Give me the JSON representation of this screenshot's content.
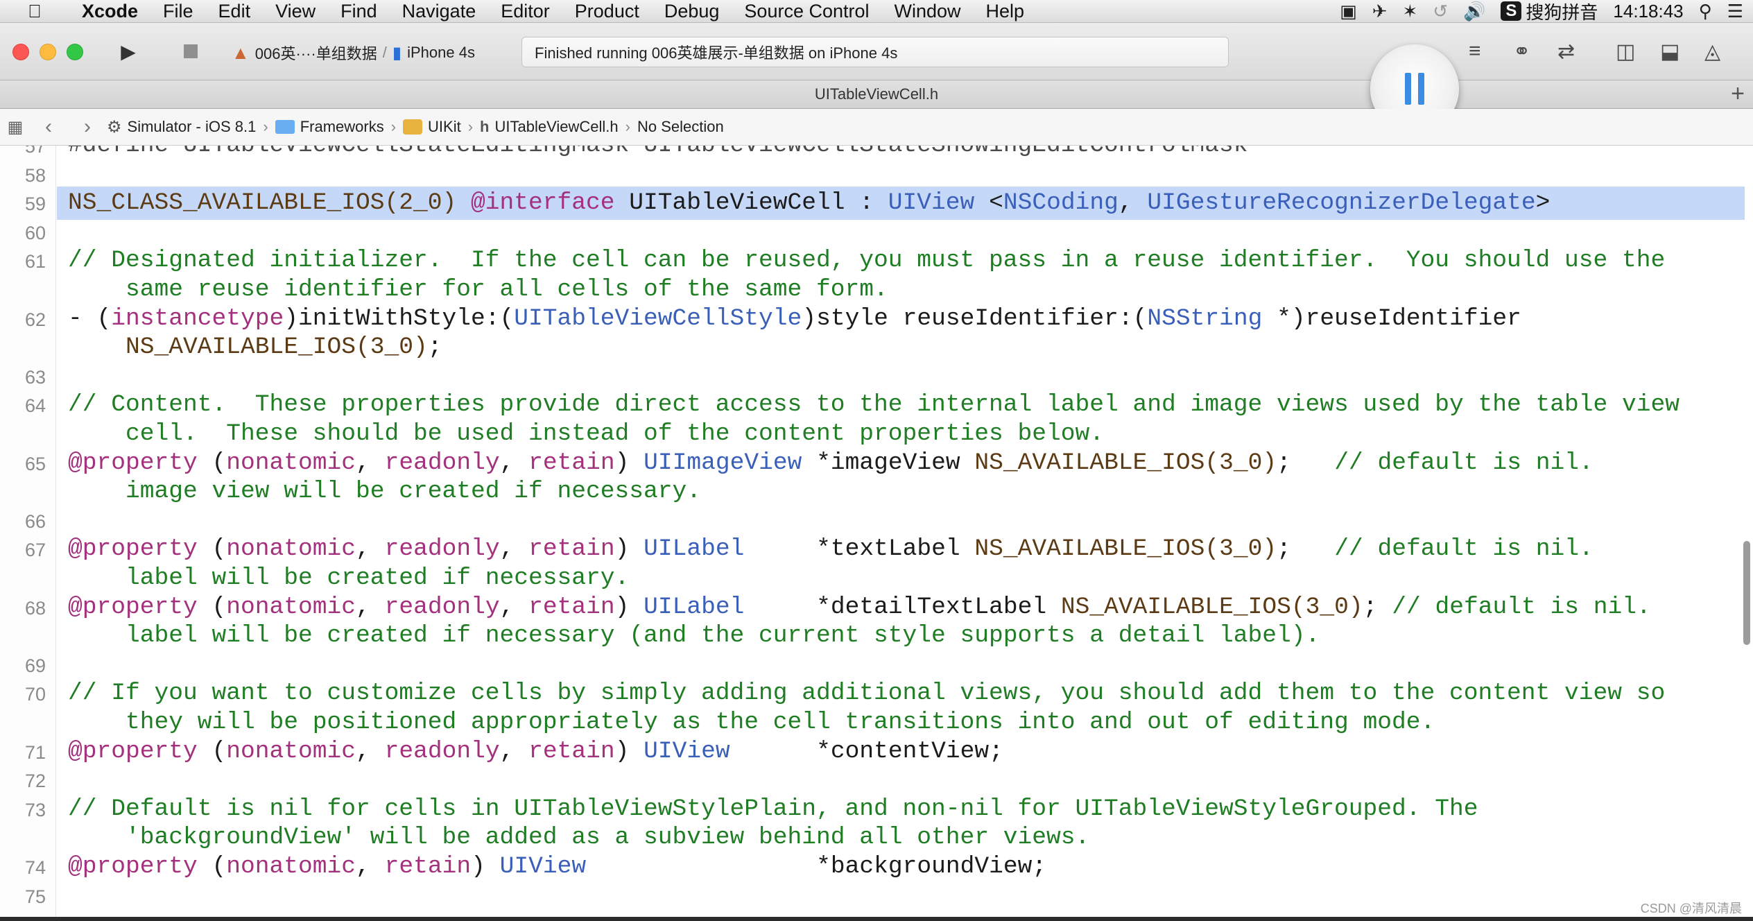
{
  "menubar": {
    "app_name": "Xcode",
    "items": [
      "File",
      "Edit",
      "View",
      "Find",
      "Navigate",
      "Editor",
      "Product",
      "Debug",
      "Source Control",
      "Window",
      "Help"
    ],
    "ime_label": "搜狗拼音",
    "ime_badge": "S",
    "clock": "14:18:43"
  },
  "toolbar": {
    "scheme_name": "006英····单组数据",
    "device": "iPhone 4s",
    "activity_status": "Finished running 006英雄展示-单组数据 on iPhone 4s"
  },
  "tabbar": {
    "title": "UITableViewCell.h",
    "add_tab_symbol": "+"
  },
  "jumpbar": {
    "crumbs": [
      "Simulator - iOS 8.1",
      "Frameworks",
      "UIKit",
      "UITableViewCell.h",
      "No Selection"
    ]
  },
  "editor": {
    "lines": [
      {
        "num": "57",
        "tokens": [
          {
            "c": "t-faded",
            "t": "#define UITableViewCellStateEditingMask UITableViewCellStateShowingEditControlMask"
          }
        ]
      },
      {
        "num": "58",
        "tokens": []
      },
      {
        "num": "59",
        "highlight": true,
        "tokens": [
          {
            "c": "t-macro",
            "t": "NS_CLASS_AVAILABLE_IOS(2_0) "
          },
          {
            "c": "t-kw",
            "t": "@interface"
          },
          {
            "c": "t-plain",
            "t": " UITableViewCell : "
          },
          {
            "c": "t-type",
            "t": "UIView"
          },
          {
            "c": "t-plain",
            "t": " <"
          },
          {
            "c": "t-type",
            "t": "NSCoding"
          },
          {
            "c": "t-plain",
            "t": ", "
          },
          {
            "c": "t-type",
            "t": "UIGestureRecognizerDelegate"
          },
          {
            "c": "t-plain",
            "t": ">"
          }
        ]
      },
      {
        "num": "60",
        "tokens": []
      },
      {
        "num": "61",
        "tokens": [
          {
            "c": "t-comment",
            "t": "// Designated initializer.  If the cell can be reused, you must pass in a reuse identifier.  You should use the"
          }
        ]
      },
      {
        "num": "",
        "tokens": [
          {
            "c": "t-comment",
            "t": "    same reuse identifier for all cells of the same form."
          }
        ]
      },
      {
        "num": "62",
        "tokens": [
          {
            "c": "t-plain",
            "t": "- ("
          },
          {
            "c": "t-kw",
            "t": "instancetype"
          },
          {
            "c": "t-plain",
            "t": ")initWithStyle:("
          },
          {
            "c": "t-type",
            "t": "UITableViewCellStyle"
          },
          {
            "c": "t-plain",
            "t": ")style reuseIdentifier:("
          },
          {
            "c": "t-type",
            "t": "NSString"
          },
          {
            "c": "t-plain",
            "t": " *)reuseIdentifier"
          }
        ]
      },
      {
        "num": "",
        "tokens": [
          {
            "c": "t-macro",
            "t": "    NS_AVAILABLE_IOS(3_0)"
          },
          {
            "c": "t-plain",
            "t": ";"
          }
        ]
      },
      {
        "num": "63",
        "tokens": []
      },
      {
        "num": "64",
        "tokens": [
          {
            "c": "t-comment",
            "t": "// Content.  These properties provide direct access to the internal label and image views used by the table view"
          }
        ]
      },
      {
        "num": "",
        "tokens": [
          {
            "c": "t-comment",
            "t": "    cell.  These should be used instead of the content properties below."
          }
        ]
      },
      {
        "num": "65",
        "tokens": [
          {
            "c": "t-kw",
            "t": "@property"
          },
          {
            "c": "t-plain",
            "t": " ("
          },
          {
            "c": "t-kw",
            "t": "nonatomic"
          },
          {
            "c": "t-plain",
            "t": ", "
          },
          {
            "c": "t-kw",
            "t": "readonly"
          },
          {
            "c": "t-plain",
            "t": ", "
          },
          {
            "c": "t-kw",
            "t": "retain"
          },
          {
            "c": "t-plain",
            "t": ") "
          },
          {
            "c": "t-type",
            "t": "UIImageView"
          },
          {
            "c": "t-plain",
            "t": " *imageView "
          },
          {
            "c": "t-macro",
            "t": "NS_AVAILABLE_IOS(3_0)"
          },
          {
            "c": "t-plain",
            "t": ";   "
          },
          {
            "c": "t-comment",
            "t": "// default is nil."
          }
        ]
      },
      {
        "num": "",
        "tokens": [
          {
            "c": "t-comment",
            "t": "    image view will be created if necessary."
          }
        ]
      },
      {
        "num": "66",
        "tokens": []
      },
      {
        "num": "67",
        "tokens": [
          {
            "c": "t-kw",
            "t": "@property"
          },
          {
            "c": "t-plain",
            "t": " ("
          },
          {
            "c": "t-kw",
            "t": "nonatomic"
          },
          {
            "c": "t-plain",
            "t": ", "
          },
          {
            "c": "t-kw",
            "t": "readonly"
          },
          {
            "c": "t-plain",
            "t": ", "
          },
          {
            "c": "t-kw",
            "t": "retain"
          },
          {
            "c": "t-plain",
            "t": ") "
          },
          {
            "c": "t-type",
            "t": "UILabel"
          },
          {
            "c": "t-plain",
            "t": "     *textLabel "
          },
          {
            "c": "t-macro",
            "t": "NS_AVAILABLE_IOS(3_0)"
          },
          {
            "c": "t-plain",
            "t": ";   "
          },
          {
            "c": "t-comment",
            "t": "// default is nil."
          }
        ]
      },
      {
        "num": "",
        "tokens": [
          {
            "c": "t-comment",
            "t": "    label will be created if necessary."
          }
        ]
      },
      {
        "num": "68",
        "tokens": [
          {
            "c": "t-kw",
            "t": "@property"
          },
          {
            "c": "t-plain",
            "t": " ("
          },
          {
            "c": "t-kw",
            "t": "nonatomic"
          },
          {
            "c": "t-plain",
            "t": ", "
          },
          {
            "c": "t-kw",
            "t": "readonly"
          },
          {
            "c": "t-plain",
            "t": ", "
          },
          {
            "c": "t-kw",
            "t": "retain"
          },
          {
            "c": "t-plain",
            "t": ") "
          },
          {
            "c": "t-type",
            "t": "UILabel"
          },
          {
            "c": "t-plain",
            "t": "     *detailTextLabel "
          },
          {
            "c": "t-macro",
            "t": "NS_AVAILABLE_IOS(3_0)"
          },
          {
            "c": "t-plain",
            "t": "; "
          },
          {
            "c": "t-comment",
            "t": "// default is nil."
          }
        ]
      },
      {
        "num": "",
        "tokens": [
          {
            "c": "t-comment",
            "t": "    label will be created if necessary (and the current style supports a detail label)."
          }
        ]
      },
      {
        "num": "69",
        "tokens": []
      },
      {
        "num": "70",
        "tokens": [
          {
            "c": "t-comment",
            "t": "// If you want to customize cells by simply adding additional views, you should add them to the content view so"
          }
        ]
      },
      {
        "num": "",
        "tokens": [
          {
            "c": "t-comment",
            "t": "    they will be positioned appropriately as the cell transitions into and out of editing mode."
          }
        ]
      },
      {
        "num": "71",
        "tokens": [
          {
            "c": "t-kw",
            "t": "@property"
          },
          {
            "c": "t-plain",
            "t": " ("
          },
          {
            "c": "t-kw",
            "t": "nonatomic"
          },
          {
            "c": "t-plain",
            "t": ", "
          },
          {
            "c": "t-kw",
            "t": "readonly"
          },
          {
            "c": "t-plain",
            "t": ", "
          },
          {
            "c": "t-kw",
            "t": "retain"
          },
          {
            "c": "t-plain",
            "t": ") "
          },
          {
            "c": "t-type",
            "t": "UIView"
          },
          {
            "c": "t-plain",
            "t": "      *contentView;"
          }
        ]
      },
      {
        "num": "72",
        "tokens": []
      },
      {
        "num": "73",
        "tokens": [
          {
            "c": "t-comment",
            "t": "// Default is nil for cells in UITableViewStylePlain, and non-nil for UITableViewStyleGrouped. The"
          }
        ]
      },
      {
        "num": "",
        "tokens": [
          {
            "c": "t-comment",
            "t": "    'backgroundView' will be added as a subview behind all other views."
          }
        ]
      },
      {
        "num": "74",
        "tokens": [
          {
            "c": "t-kw",
            "t": "@property"
          },
          {
            "c": "t-plain",
            "t": " ("
          },
          {
            "c": "t-kw",
            "t": "nonatomic"
          },
          {
            "c": "t-plain",
            "t": ", "
          },
          {
            "c": "t-kw",
            "t": "retain"
          },
          {
            "c": "t-plain",
            "t": ") "
          },
          {
            "c": "t-type",
            "t": "UIView"
          },
          {
            "c": "t-plain",
            "t": "                *backgroundView;"
          }
        ]
      },
      {
        "num": "75",
        "tokens": []
      }
    ]
  },
  "watermark": "CSDN @清风清晨"
}
